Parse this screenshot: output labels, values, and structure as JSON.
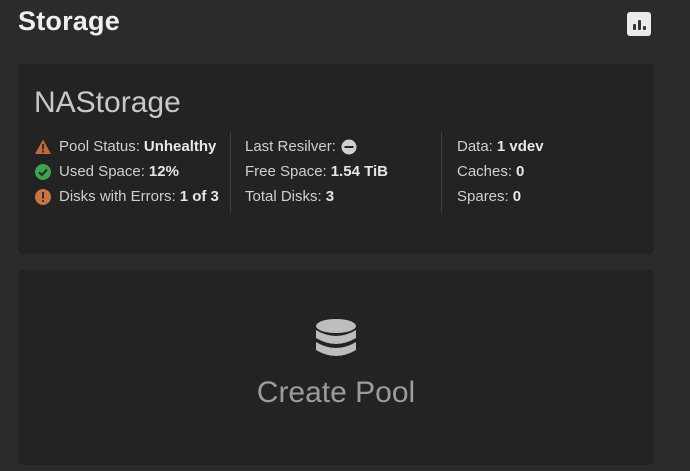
{
  "header": {
    "title": "Storage",
    "reports_icon": "bar-chart-icon"
  },
  "pool": {
    "name": "NAStorage",
    "col1": [
      {
        "label": "Pool Status:",
        "value": "Unhealthy",
        "icon": "warning-triangle-icon"
      },
      {
        "label": "Used Space:",
        "value": "12%",
        "icon": "check-circle-icon"
      },
      {
        "label": "Disks with Errors:",
        "value": "1 of 3",
        "icon": "exclamation-circle-icon"
      }
    ],
    "col2": [
      {
        "label": "Last Resilver:",
        "value": "",
        "icon": "minus-circle-icon"
      },
      {
        "label": "Free Space:",
        "value": "1.54 TiB"
      },
      {
        "label": "Total Disks:",
        "value": "3"
      }
    ],
    "col3": [
      {
        "label": "Data:",
        "value": "1 vdev"
      },
      {
        "label": "Caches:",
        "value": "0"
      },
      {
        "label": "Spares:",
        "value": "0"
      }
    ]
  },
  "create_pool": {
    "label": "Create Pool",
    "icon": "database-icon"
  },
  "colors": {
    "warning": "#c0693a",
    "success": "#3fa34d",
    "error_orange": "#c8763f",
    "neutral_badge": "#d0d0d0"
  }
}
